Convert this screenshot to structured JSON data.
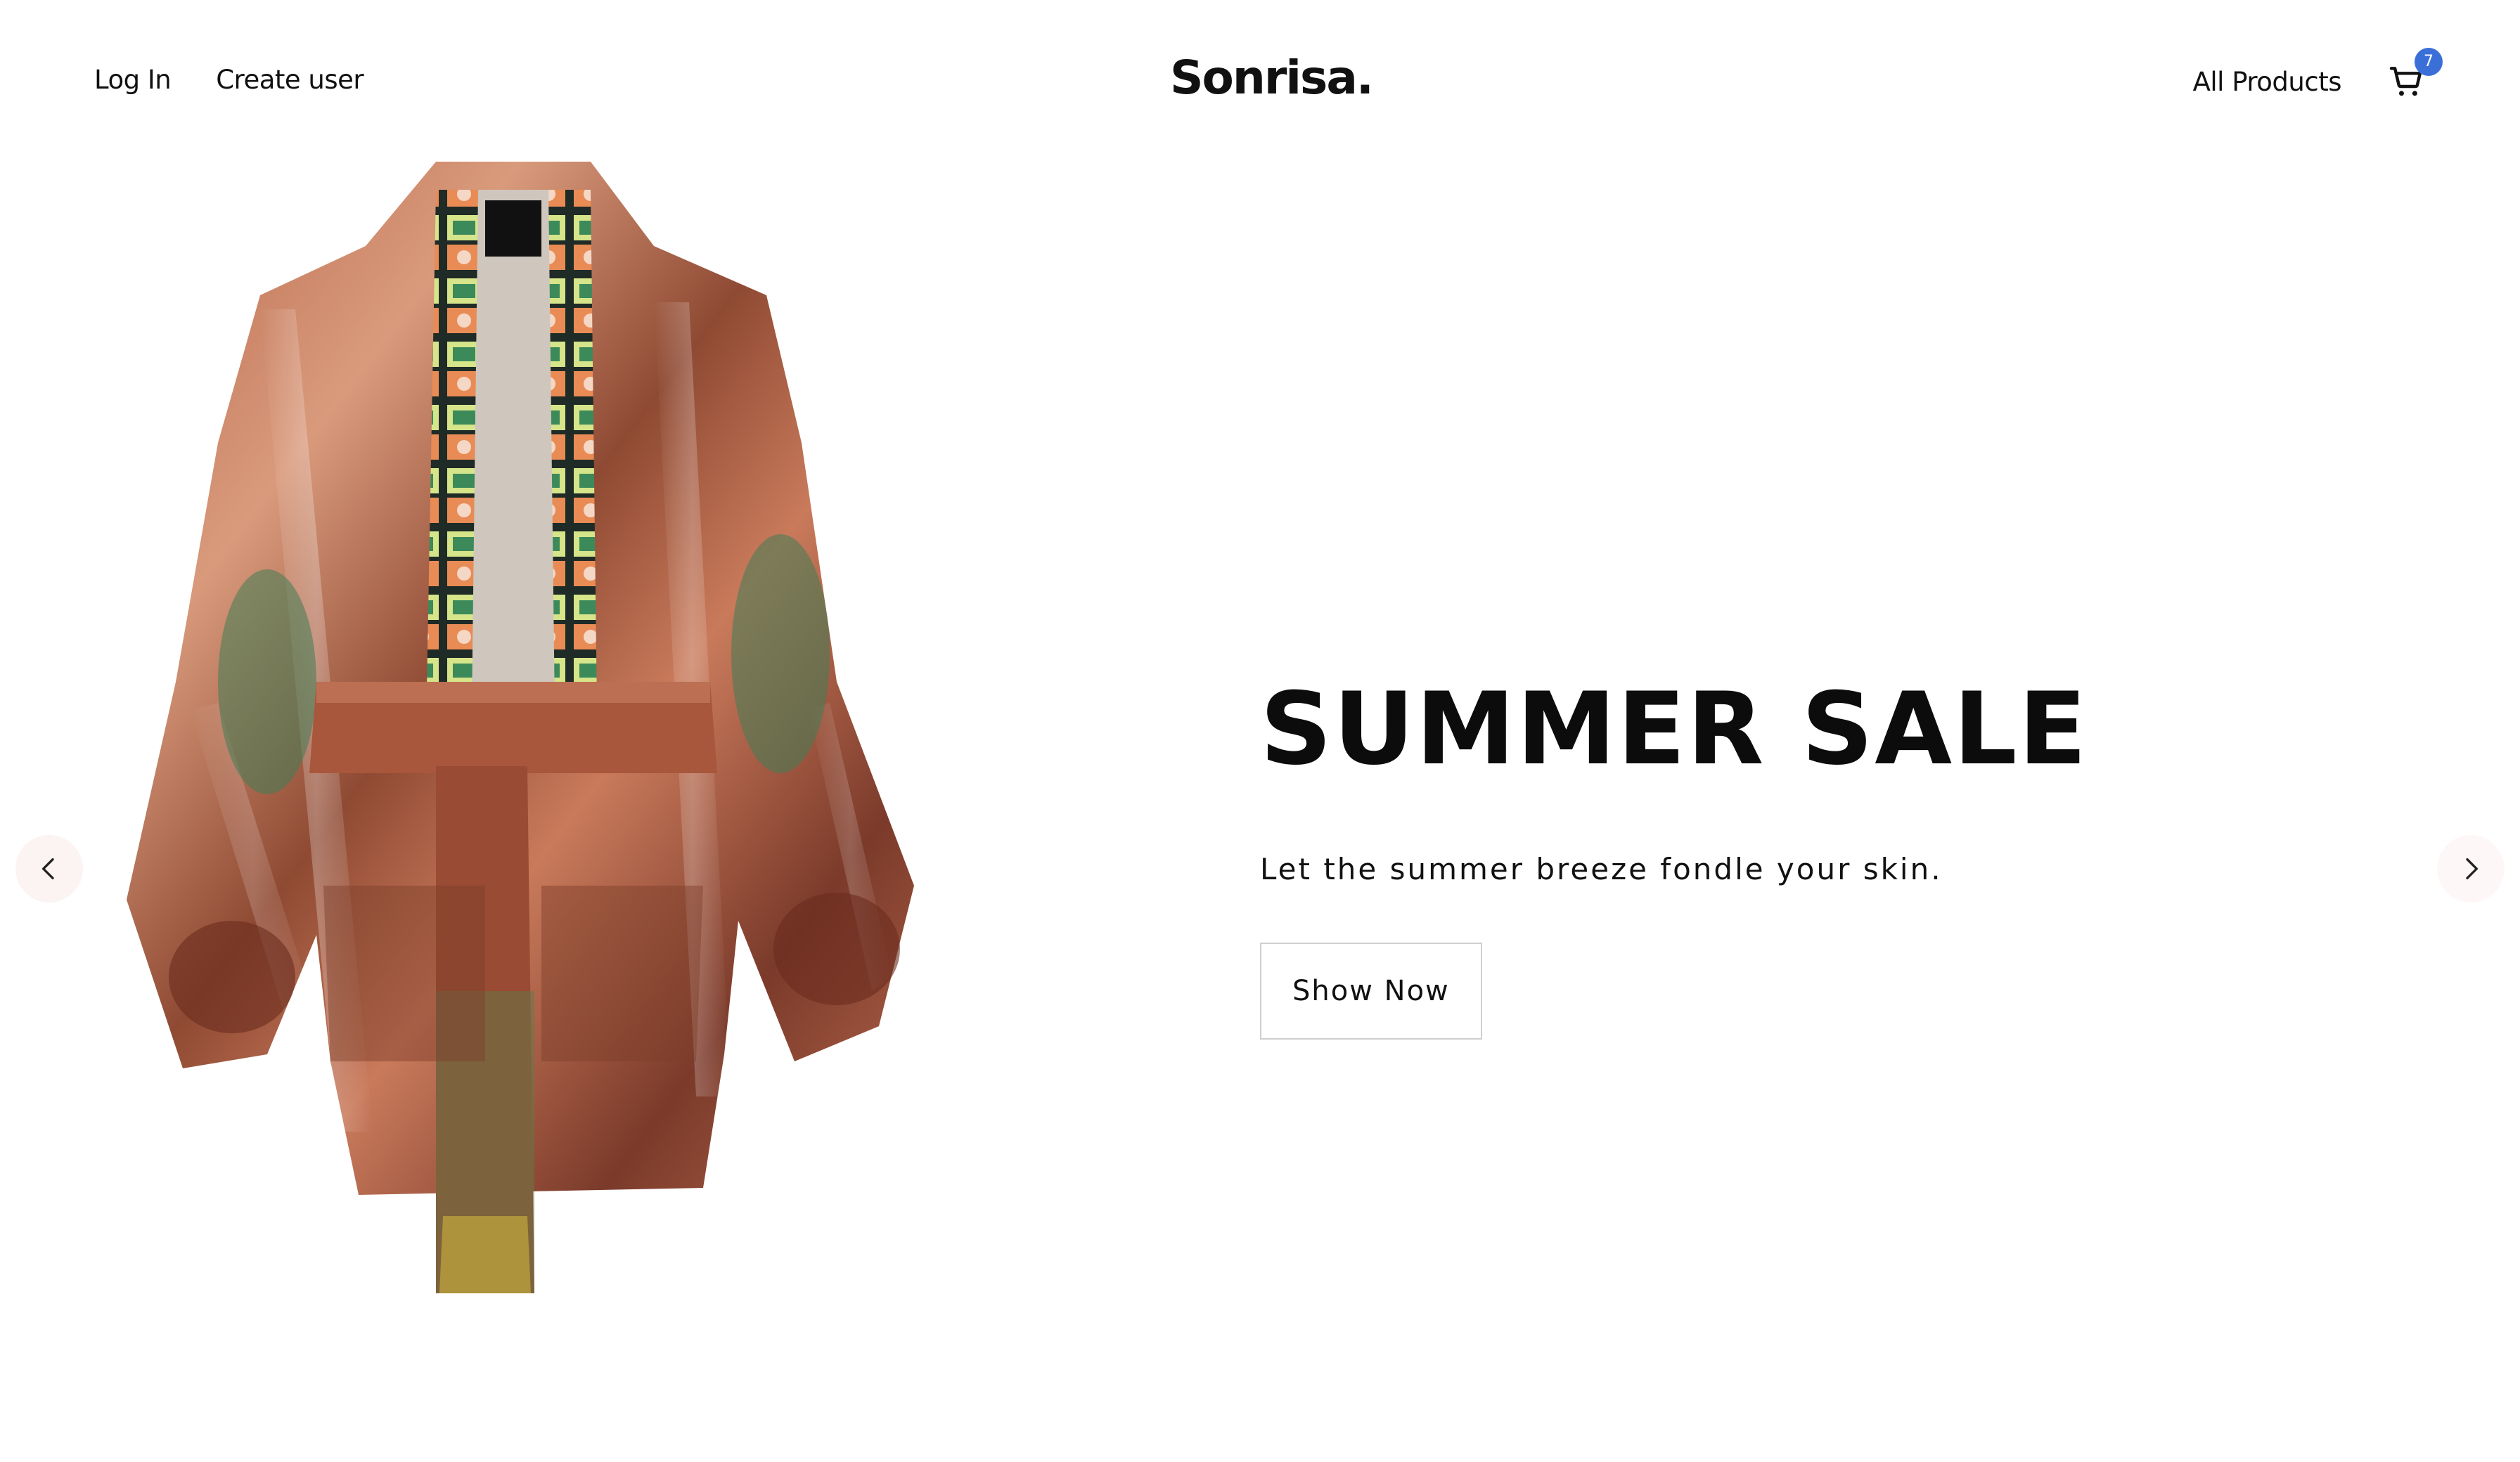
{
  "header": {
    "login_label": "Log In",
    "create_user_label": "Create user",
    "logo_text": "Sonrisa.",
    "all_products_label": "All Products",
    "cart_count": "7",
    "cart_icon": "shopping-cart-icon"
  },
  "hero": {
    "title": "SUMMER SALE",
    "subtitle": "Let the summer breeze fondle your skin.",
    "button_label": "Show Now",
    "image_description_icon": "kimono-product-image"
  },
  "carousel": {
    "prev_icon": "chevron-left-icon",
    "next_icon": "chevron-right-icon"
  },
  "colors": {
    "badge": "#3b6fd8",
    "button_border": "#cfcfcf",
    "text": "#111111"
  }
}
